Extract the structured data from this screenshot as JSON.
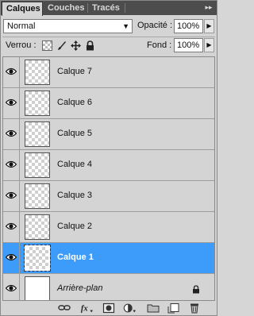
{
  "tabs": [
    {
      "label": "Calques",
      "active": true
    },
    {
      "label": "Couches",
      "active": false
    },
    {
      "label": "Tracés",
      "active": false
    }
  ],
  "blend": {
    "mode": "Normal"
  },
  "opacity": {
    "label": "Opacité :",
    "value": "100%"
  },
  "lock": {
    "label": "Verrou :"
  },
  "fill": {
    "label": "Fond :",
    "value": "100%"
  },
  "layers": [
    {
      "name": "Calque 7",
      "visible": true,
      "selected": false
    },
    {
      "name": "Calque 6",
      "visible": true,
      "selected": false
    },
    {
      "name": "Calque 5",
      "visible": true,
      "selected": false
    },
    {
      "name": "Calque 4",
      "visible": true,
      "selected": false
    },
    {
      "name": "Calque 3",
      "visible": true,
      "selected": false
    },
    {
      "name": "Calque 2",
      "visible": true,
      "selected": false
    },
    {
      "name": "Calque 1",
      "visible": true,
      "selected": true
    },
    {
      "name": "Arrière-plan",
      "visible": true,
      "selected": false,
      "locked": true
    }
  ],
  "bottom_icons": [
    "link-icon",
    "fx-icon",
    "mask-icon",
    "adjustment-icon",
    "folder-icon",
    "new-layer-icon",
    "trash-icon"
  ],
  "colors": {
    "selection": "#3d9bfa",
    "tab_bar": "#4d4d4d",
    "panel": "#d4d4d4"
  }
}
